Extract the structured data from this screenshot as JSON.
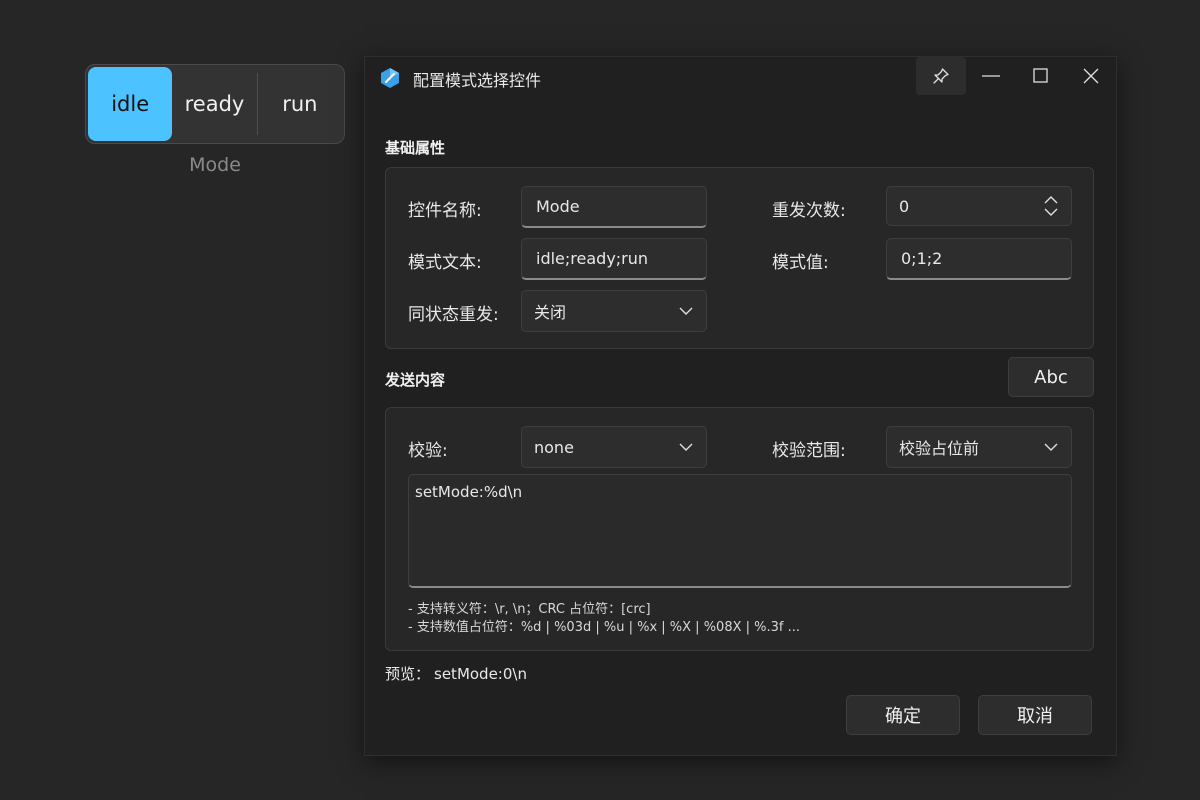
{
  "mode_selector": {
    "options": [
      "idle",
      "ready",
      "run"
    ],
    "selected_index": 0,
    "caption": "Mode"
  },
  "dialog": {
    "title": "配置模式选择控件",
    "titlebar_icons": [
      "pin-icon",
      "minimize-icon",
      "maximize-icon",
      "close-icon"
    ],
    "basic": {
      "section_title": "基础属性",
      "name_label": "控件名称:",
      "name_value": "Mode",
      "repeat_label": "重发次数:",
      "repeat_value": "0",
      "mode_text_label": "模式文本:",
      "mode_text_value": "idle;ready;run",
      "mode_value_label": "模式值:",
      "mode_value_value": "0;1;2",
      "same_state_label": "同状态重发:",
      "same_state_value": "关闭"
    },
    "send": {
      "section_title": "发送内容",
      "format_button": "Abc",
      "checksum_label": "校验:",
      "checksum_value": "none",
      "range_label": "校验范围:",
      "range_value": "校验占位前",
      "content": "setMode:%d\\n",
      "hint1": "- 支持转义符：\\r, \\n；CRC 占位符：[crc]",
      "hint2": "- 支持数值占位符：%d | %03d | %u | %x | %X | %08X | %.3f ..."
    },
    "preview_label": "预览：",
    "preview_value": "setMode:0\\n",
    "ok_button": "确定",
    "cancel_button": "取消"
  },
  "colors": {
    "accent": "#4cc2ff",
    "background": "#262626",
    "dialog_background": "#202020"
  }
}
